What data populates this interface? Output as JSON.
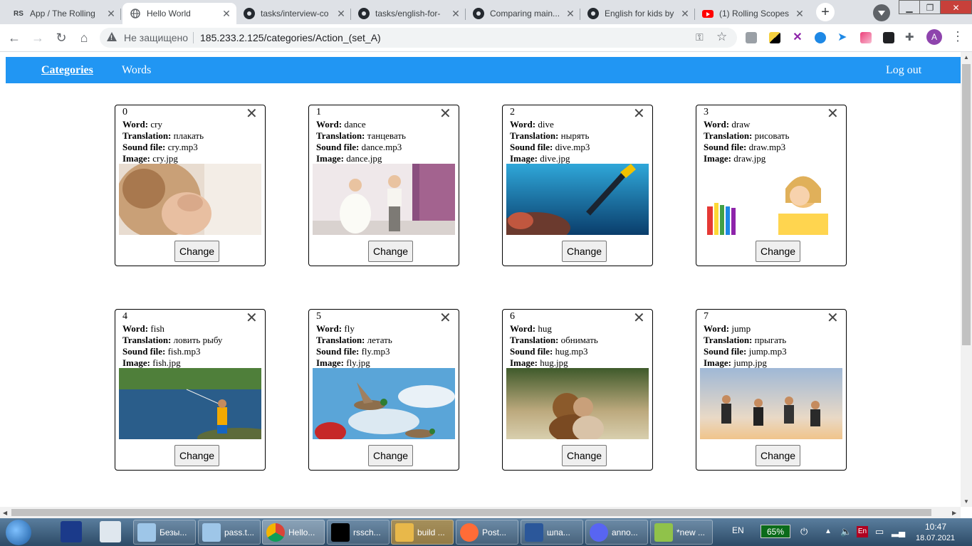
{
  "browser": {
    "tabs": [
      {
        "title": "App / The Rolling",
        "icon": "rs-icon",
        "active": false
      },
      {
        "title": "Hello World",
        "icon": "globe-icon",
        "active": true
      },
      {
        "title": "tasks/interview-co",
        "icon": "github-icon",
        "active": false
      },
      {
        "title": "tasks/english-for-",
        "icon": "github-icon",
        "active": false
      },
      {
        "title": "Comparing main...",
        "icon": "github-icon",
        "active": false
      },
      {
        "title": "English for kids by",
        "icon": "github-icon",
        "active": false
      },
      {
        "title": "(1) Rolling Scopes",
        "icon": "youtube-icon",
        "active": false
      }
    ],
    "rs_label": "RS",
    "security_label": "Не защищено",
    "url": "185.233.2.125/categories/Action_(set_A)",
    "avatar_letter": "A"
  },
  "nav": {
    "categories": "Categories",
    "words": "Words",
    "logout": "Log out",
    "color": "#2196f3"
  },
  "labels": {
    "word": "Word:",
    "translation": "Translation:",
    "sound": "Sound file:",
    "image": "Image:",
    "change": "Change"
  },
  "cards": [
    {
      "index": "0",
      "word": "cry",
      "translation": "плакать",
      "sound": "cry.mp3",
      "image": "cry.jpg"
    },
    {
      "index": "1",
      "word": "dance",
      "translation": "танцевать",
      "sound": "dance.mp3",
      "image": "dance.jpg"
    },
    {
      "index": "2",
      "word": "dive",
      "translation": "нырять",
      "sound": "dive.mp3",
      "image": "dive.jpg"
    },
    {
      "index": "3",
      "word": "draw",
      "translation": "рисовать",
      "sound": "draw.mp3",
      "image": "draw.jpg"
    },
    {
      "index": "4",
      "word": "fish",
      "translation": "ловить рыбу",
      "sound": "fish.mp3",
      "image": "fish.jpg"
    },
    {
      "index": "5",
      "word": "fly",
      "translation": "летать",
      "sound": "fly.mp3",
      "image": "fly.jpg"
    },
    {
      "index": "6",
      "word": "hug",
      "translation": "обнимать",
      "sound": "hug.mp3",
      "image": "hug.jpg"
    },
    {
      "index": "7",
      "word": "jump",
      "translation": "прыгать",
      "sound": "jump.mp3",
      "image": "jump.jpg"
    }
  ],
  "taskbar": {
    "items": [
      {
        "label": "Безы...",
        "icon": "notepad-icon"
      },
      {
        "label": "pass.t...",
        "icon": "notepad-icon"
      },
      {
        "label": "Hello...",
        "icon": "chrome-icon"
      },
      {
        "label": "rssch...",
        "icon": "webstorm-icon"
      },
      {
        "label": "build ...",
        "icon": "folder-icon"
      },
      {
        "label": "Post...",
        "icon": "postman-icon"
      },
      {
        "label": "шпа...",
        "icon": "document-icon"
      },
      {
        "label": "anno...",
        "icon": "discord-icon"
      },
      {
        "label": "*new ...",
        "icon": "notepadpp-icon"
      }
    ],
    "lang": "EN",
    "battery": "65%",
    "tray_lang": "En",
    "time": "10:47",
    "date": "18.07.2021"
  }
}
